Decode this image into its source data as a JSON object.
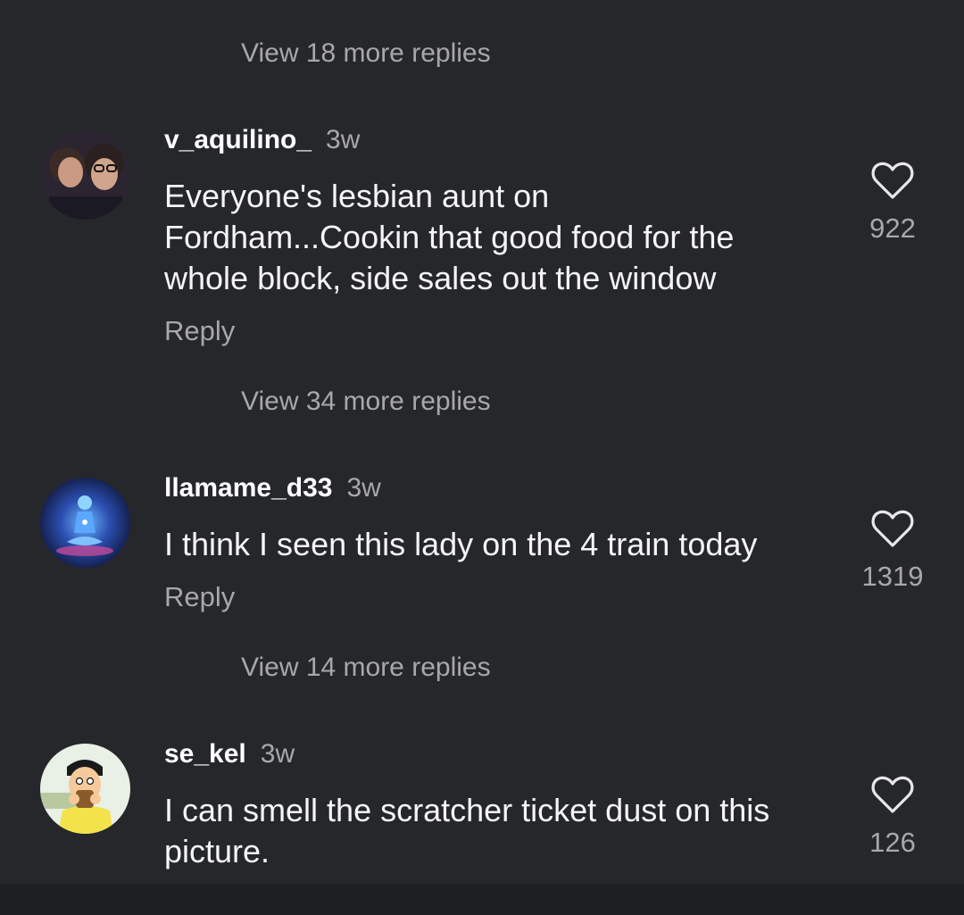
{
  "view_more": [
    {
      "label": "View 18 more replies"
    },
    {
      "label": "View 34 more replies"
    },
    {
      "label": "View 14 more replies"
    }
  ],
  "comments": [
    {
      "username": "v_aquilino_",
      "time": "3w",
      "text": "Everyone's lesbian aunt on Fordham...Cookin that good food for the whole block, side sales out the window",
      "reply": "Reply",
      "likes": "922"
    },
    {
      "username": "llamame_d33",
      "time": "3w",
      "text": "I think I seen this lady on the 4 train today",
      "reply": "Reply",
      "likes": "1319"
    },
    {
      "username": "se_kel",
      "time": "3w",
      "text": "I can smell the scratcher ticket dust on this picture.",
      "likes": "126"
    }
  ],
  "colors": {
    "background": "#25272b",
    "text_primary": "#f5f5f5",
    "text_secondary": "#a8a8a8"
  }
}
